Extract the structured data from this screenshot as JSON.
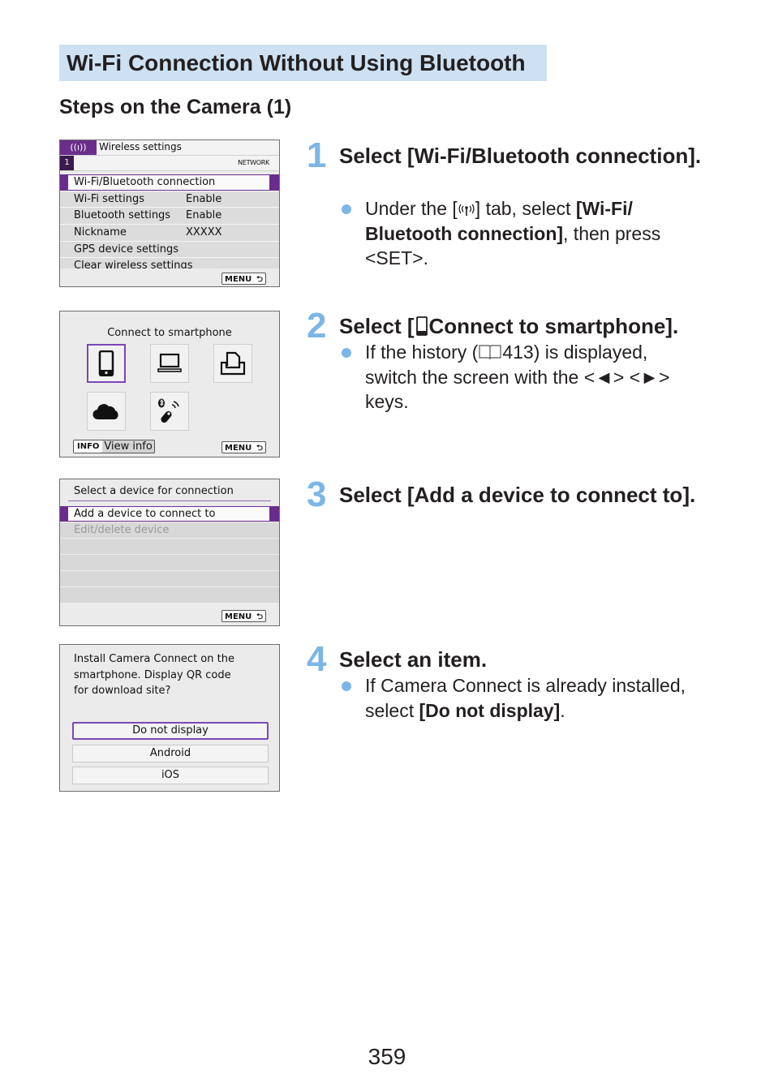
{
  "section_title": "Wi-Fi Connection Without Using Bluetooth",
  "sub_title": "Steps on the Camera (1)",
  "screens": {
    "wireless_settings": {
      "tab_icon": "wireless-icon",
      "tab_icon_glyph": "((ı))",
      "title": "Wireless settings",
      "tab_number": "1",
      "tab_label": "NETWORK",
      "items": [
        {
          "label": "Wi-Fi/Bluetooth connection",
          "value": "",
          "selected": true
        },
        {
          "label": "Wi-Fi settings",
          "value": "Enable"
        },
        {
          "label": "Bluetooth settings",
          "value": "Enable"
        },
        {
          "label": "Nickname",
          "value": "XXXXX"
        },
        {
          "label": "GPS device settings",
          "value": ""
        },
        {
          "label": "Clear wireless settings",
          "value": ""
        }
      ],
      "menu_button": "MENU",
      "back_glyph": "⮌"
    },
    "connect_smartphone": {
      "heading": "Connect to smartphone",
      "tiles": [
        {
          "icon": "smartphone-icon",
          "selected": true
        },
        {
          "icon": "computer-icon"
        },
        {
          "icon": "printer-icon"
        },
        {
          "icon": "cloud-icon"
        },
        {
          "icon": "bluetooth-remote-icon"
        }
      ],
      "info_key": "INFO",
      "info_label": "View info",
      "menu_button": "MENU",
      "back_glyph": "⮌"
    },
    "select_device": {
      "heading": "Select a device for connection",
      "items": [
        {
          "label": "Add a device to connect to",
          "selected": true
        },
        {
          "label": "Edit/delete device",
          "disabled": true
        },
        {
          "label": ""
        },
        {
          "label": ""
        },
        {
          "label": ""
        },
        {
          "label": ""
        }
      ],
      "menu_button": "MENU",
      "back_glyph": "⮌"
    },
    "install_app": {
      "message": "Install Camera Connect on the\nsmartphone. Display QR code\nfor download site?",
      "options": [
        "Do not display",
        "Android",
        "iOS"
      ],
      "selected_option": "Do not display"
    }
  },
  "steps": [
    {
      "number": "1",
      "title": "Select [Wi-Fi/Bluetooth connection].",
      "bullet": {
        "pre": "Under the [",
        "icon": "wireless-icon",
        "mid": "] tab, select ",
        "bold": "[Wi-Fi/ Bluetooth connection]",
        "post": ", then press <SET>."
      }
    },
    {
      "number": "2",
      "title_pre": "Select [",
      "title_icon": "smartphone-icon",
      "title_post": "Connect to smartphone].",
      "bullet": {
        "pre": "If the history (",
        "icon": "book-icon",
        "ref": "413",
        "post": ") is displayed, switch the screen with the <◄> <►> keys."
      }
    },
    {
      "number": "3",
      "title": "Select [Add a device to connect to]."
    },
    {
      "number": "4",
      "title": "Select an item.",
      "bullet": {
        "pre": "If Camera Connect is already installed, select ",
        "bold": "[Do not display]",
        "post": "."
      }
    }
  ],
  "page_number": "359",
  "colors": {
    "title_bg": "#cde1f3",
    "step_accent": "#7cb6e6",
    "camera_purple": "#6b2d8b",
    "selection_border": "#7b47b5"
  }
}
